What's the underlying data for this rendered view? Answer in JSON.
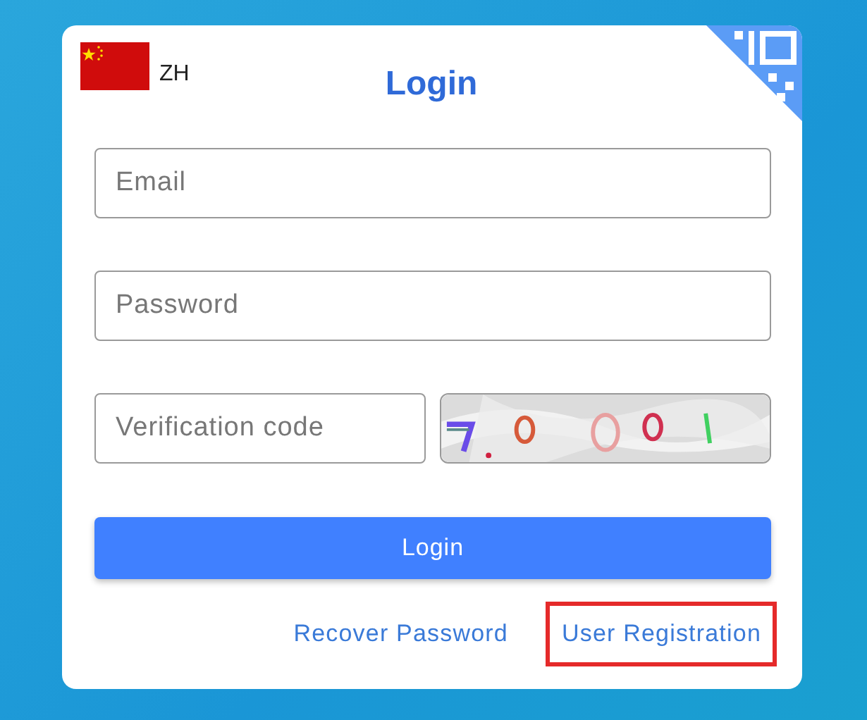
{
  "language": {
    "code": "ZH"
  },
  "title": "Login",
  "fields": [
    {
      "placeholder": "Email"
    },
    {
      "placeholder": "Password"
    }
  ],
  "verification": {
    "placeholder": "Verification code"
  },
  "login_button": "Login",
  "links": [
    {
      "label": "Recover Password",
      "highlighted": false
    },
    {
      "label": "User Registration",
      "highlighted": true
    }
  ]
}
